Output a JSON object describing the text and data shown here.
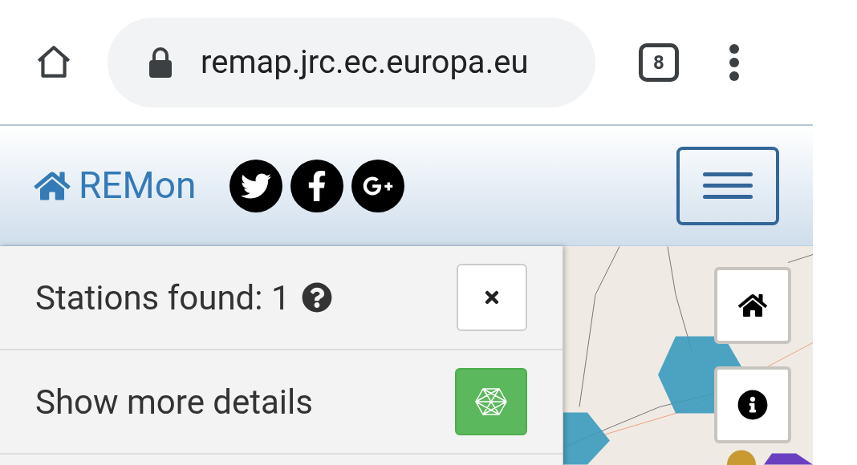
{
  "browser": {
    "url": "remap.jrc.ec.europa.eu",
    "tab_count": "8"
  },
  "navbar": {
    "brand": "REMon"
  },
  "panel": {
    "stations_label": "Stations found: 1",
    "details_label": "Show more details"
  }
}
